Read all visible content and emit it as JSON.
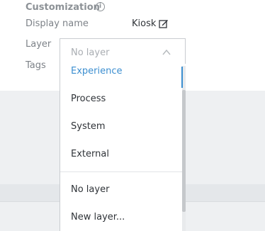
{
  "section": {
    "title": "Customization",
    "info_icon": "info-circle-icon"
  },
  "fields": {
    "display_name_label": "Display name",
    "display_name_value": "Kiosk",
    "layer_label": "Layer",
    "tags_label": "Tags"
  },
  "layer_select": {
    "value": "No layer",
    "options": [
      "Experience",
      "Process",
      "System",
      "External",
      "No layer",
      "New layer..."
    ],
    "highlighted": "Experience"
  },
  "colors": {
    "accent": "#3b8ed0",
    "text": "#2f3338",
    "muted": "#7d8288"
  }
}
